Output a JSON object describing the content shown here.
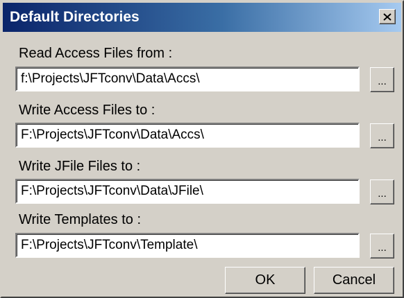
{
  "window": {
    "title": "Default Directories",
    "close_icon": "close-icon"
  },
  "fields": [
    {
      "label": "Read Access Files from :",
      "value": "f:\\Projects\\JFTconv\\Data\\Accs\\",
      "browse_label": "..."
    },
    {
      "label": "Write Access Files to :",
      "value": "F:\\Projects\\JFTconv\\Data\\Accs\\",
      "browse_label": "..."
    },
    {
      "label": "Write JFile Files to :",
      "value": "F:\\Projects\\JFTconv\\Data\\JFile\\",
      "browse_label": "..."
    },
    {
      "label": "Write Templates to :",
      "value": "F:\\Projects\\JFTconv\\Template\\",
      "browse_label": "..."
    }
  ],
  "buttons": {
    "ok_label": "OK",
    "cancel_label": "Cancel"
  },
  "colors": {
    "titlebar_start": "#0a246a",
    "titlebar_end": "#a6caf0",
    "face": "#d4d0c8"
  }
}
